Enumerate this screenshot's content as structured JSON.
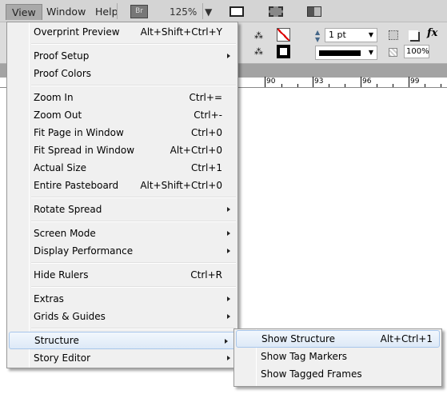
{
  "menubar": {
    "items": [
      {
        "label": "View",
        "active": true
      },
      {
        "label": "Window"
      },
      {
        "label": "Help"
      }
    ],
    "bridge_label": "Br",
    "zoom": "125%"
  },
  "toolbar": {
    "stroke_weight": "1 pt",
    "opacity": "100%",
    "fx_label": "fx"
  },
  "ruler": {
    "labels": [
      "90",
      "93",
      "96",
      "99"
    ]
  },
  "view_menu": {
    "items": [
      {
        "type": "item",
        "label": "Overprint Preview",
        "shortcut": "Alt+Shift+Ctrl+Y"
      },
      {
        "type": "sep"
      },
      {
        "type": "item",
        "label": "Proof Setup",
        "submenu": true
      },
      {
        "type": "item",
        "label": "Proof Colors"
      },
      {
        "type": "sep"
      },
      {
        "type": "item",
        "label": "Zoom In",
        "shortcut": "Ctrl+="
      },
      {
        "type": "item",
        "label": "Zoom Out",
        "shortcut": "Ctrl+-"
      },
      {
        "type": "item",
        "label": "Fit Page in Window",
        "shortcut": "Ctrl+0"
      },
      {
        "type": "item",
        "label": "Fit Spread in Window",
        "shortcut": "Alt+Ctrl+0"
      },
      {
        "type": "item",
        "label": "Actual Size",
        "shortcut": "Ctrl+1"
      },
      {
        "type": "item",
        "label": "Entire Pasteboard",
        "shortcut": "Alt+Shift+Ctrl+0"
      },
      {
        "type": "sep"
      },
      {
        "type": "item",
        "label": "Rotate Spread",
        "submenu": true
      },
      {
        "type": "sep"
      },
      {
        "type": "item",
        "label": "Screen Mode",
        "submenu": true
      },
      {
        "type": "item",
        "label": "Display Performance",
        "submenu": true
      },
      {
        "type": "sep"
      },
      {
        "type": "item",
        "label": "Hide Rulers",
        "shortcut": "Ctrl+R"
      },
      {
        "type": "sep"
      },
      {
        "type": "item",
        "label": "Extras",
        "submenu": true
      },
      {
        "type": "item",
        "label": "Grids & Guides",
        "submenu": true
      },
      {
        "type": "sep"
      },
      {
        "type": "item",
        "label": "Structure",
        "submenu": true,
        "highlighted": true
      },
      {
        "type": "item",
        "label": "Story Editor",
        "submenu": true
      }
    ]
  },
  "structure_submenu": {
    "items": [
      {
        "label": "Show Structure",
        "shortcut": "Alt+Ctrl+1",
        "highlighted": true
      },
      {
        "label": "Show Tag Markers"
      },
      {
        "label": "Show Tagged Frames"
      }
    ]
  }
}
